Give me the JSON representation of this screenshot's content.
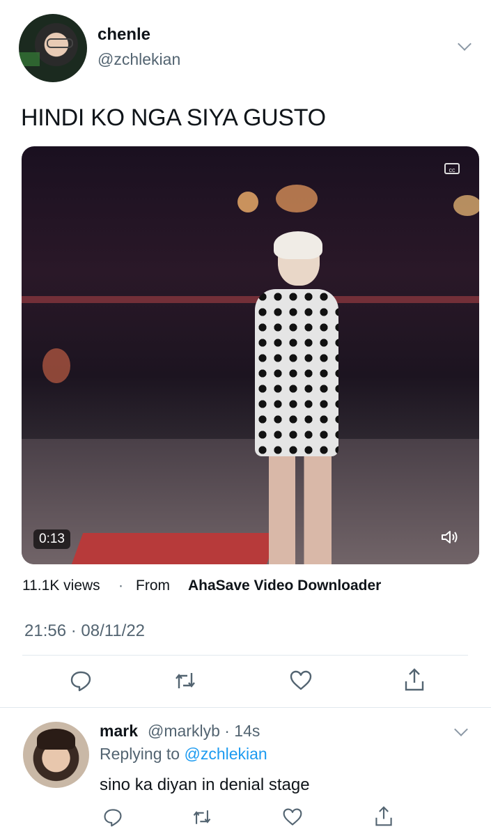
{
  "tweet": {
    "author_name": "chenle",
    "author_handle": "@zchlekian",
    "text": "HINDI KO NGA SIYA GUSTO",
    "video": {
      "duration": "0:13",
      "captions_label": "cc"
    },
    "views": "11.1K views",
    "separator": "·",
    "from_label": "From",
    "source_app": "AhaSave Video Downloader",
    "timestamp": "21:56 · 08/11/22"
  },
  "reply": {
    "author_name": "mark",
    "author_handle": "@marklyb · 14s",
    "replying_prefix": "Replying to ",
    "replying_handle": "@zchlekian",
    "text": "sino ka diyan in denial stage"
  },
  "icons": [
    "avatar",
    "chevron-down-icon",
    "cc-icon",
    "volume-icon",
    "reply-icon",
    "retweet-icon",
    "like-icon",
    "share-icon"
  ],
  "colors": {
    "link": "#1d9bf0",
    "secondary_text": "#536471",
    "primary_text": "#0f1419"
  }
}
